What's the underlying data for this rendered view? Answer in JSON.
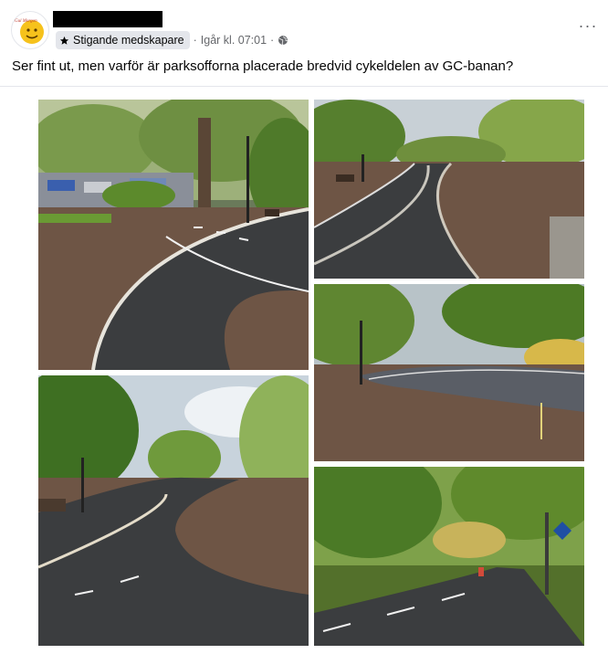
{
  "post": {
    "author_name": "",
    "badge_label": "Stigande medskapare",
    "timestamp": "Igår kl. 07:01",
    "separator": "·",
    "audience_icon": "globe-icon",
    "more_label": "···",
    "caption": "Ser fint ut, men varför är parksofforna placerade bredvid cykeldelen av GC-banan?",
    "avatar_text": "Gul Morgon"
  },
  "photos": [
    {
      "name": "photo-1",
      "description_icon": "image-icon"
    },
    {
      "name": "photo-2",
      "description_icon": "image-icon"
    },
    {
      "name": "photo-3",
      "description_icon": "image-icon"
    },
    {
      "name": "photo-4",
      "description_icon": "image-icon"
    },
    {
      "name": "photo-5",
      "description_icon": "image-icon"
    }
  ],
  "colors": {
    "text": "#050505",
    "secondary": "#65676b",
    "badge_bg": "#e4e6eb",
    "asphalt": "#3b3d3f",
    "soil": "#6e5545",
    "foliage": "#6b8f3a"
  }
}
